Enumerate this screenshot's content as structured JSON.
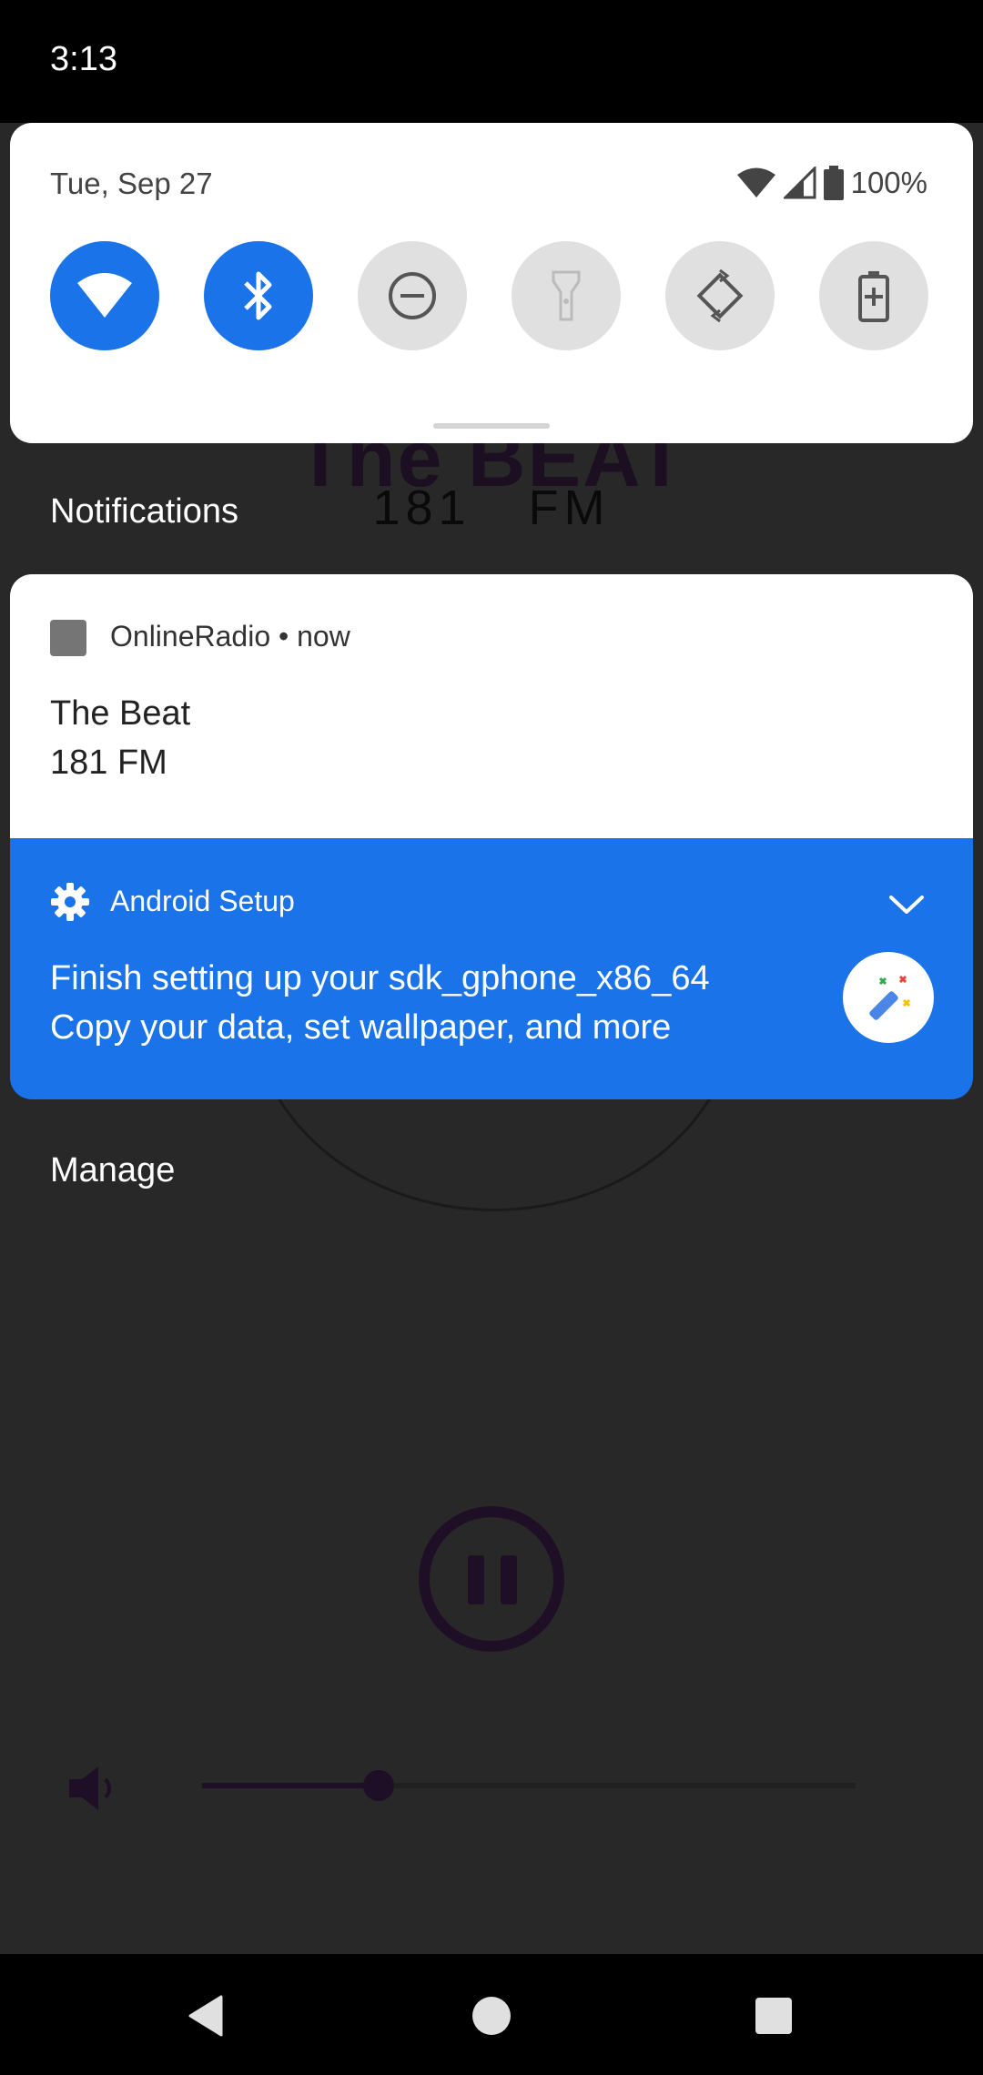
{
  "status_bar": {
    "time": "3:13"
  },
  "quick_settings": {
    "date": "Tue, Sep 27",
    "battery_percent": "100%",
    "tiles": [
      {
        "name": "wifi",
        "active": true
      },
      {
        "name": "bluetooth",
        "active": true
      },
      {
        "name": "do-not-disturb",
        "active": false
      },
      {
        "name": "flashlight",
        "active": false
      },
      {
        "name": "auto-rotate",
        "active": false
      },
      {
        "name": "battery-saver",
        "active": false
      }
    ]
  },
  "background_app": {
    "station_title": "The BEAT",
    "frequency": "181   FM",
    "volume_level": 0.27
  },
  "notifications": {
    "heading": "Notifications",
    "radio": {
      "app_name": "OnlineRadio",
      "separator": " • ",
      "time": "now",
      "title": "The Beat",
      "text": "181 FM"
    },
    "setup": {
      "app_name": "Android Setup",
      "title": "Finish setting up your sdk_gphone_x86_64",
      "text": "Copy your data, set wallpaper, and more"
    },
    "manage_label": "Manage"
  },
  "colors": {
    "accent": "#1a73e8",
    "tile_off": "#e0e0e0",
    "scrim": "#282828"
  }
}
